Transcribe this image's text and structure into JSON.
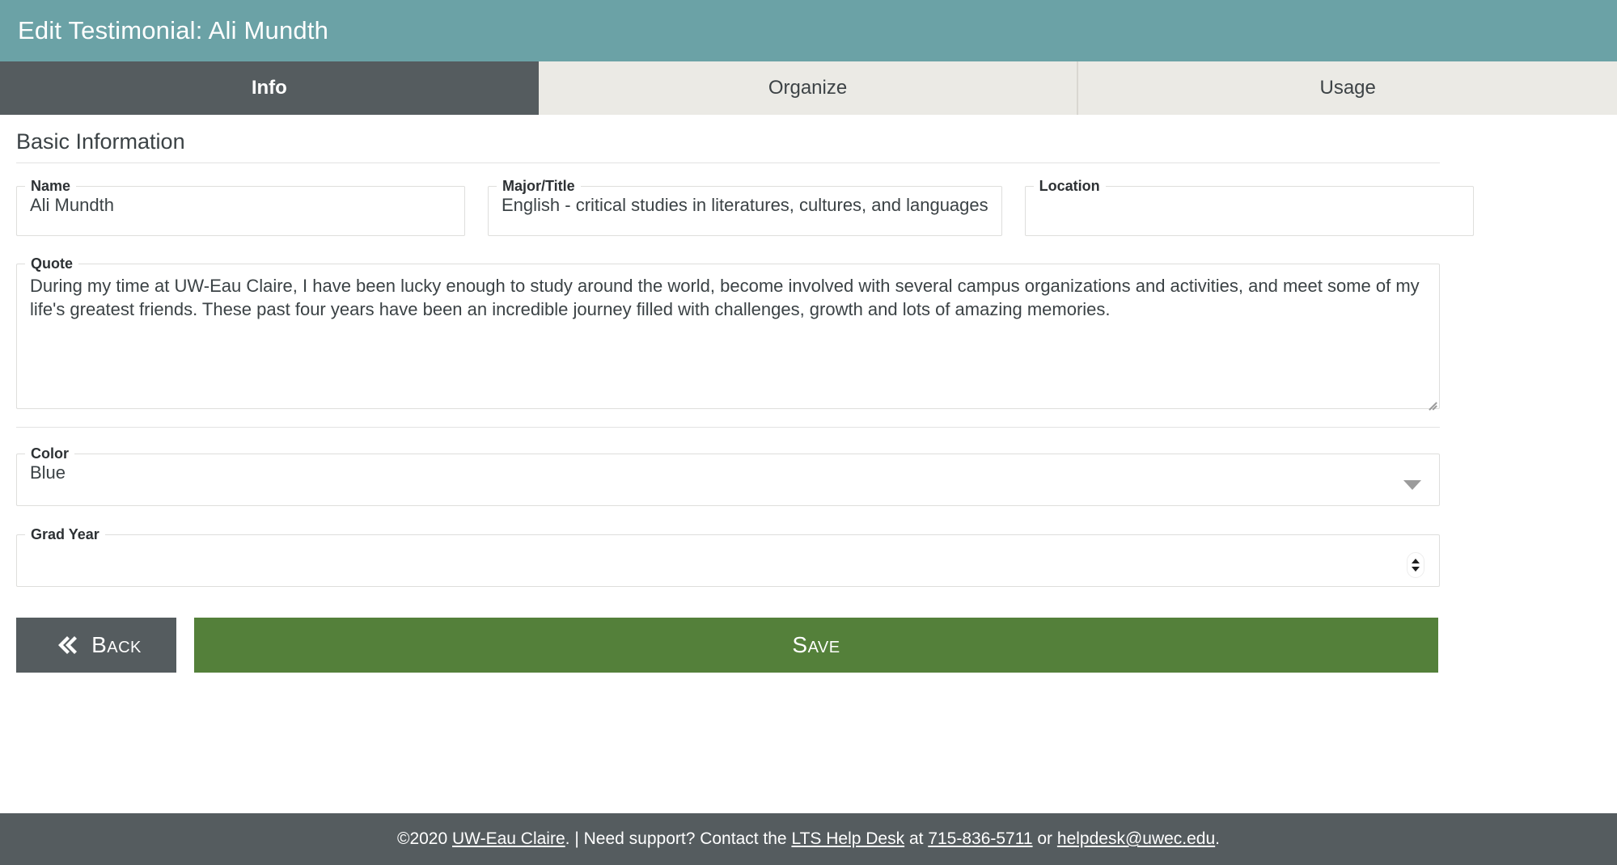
{
  "header": {
    "title": "Edit Testimonial: Ali Mundth"
  },
  "tabs": [
    {
      "label": "Info",
      "active": true
    },
    {
      "label": "Organize",
      "active": false
    },
    {
      "label": "Usage",
      "active": false
    }
  ],
  "main": {
    "section_title": "Basic Information",
    "fields": {
      "name": {
        "label": "Name",
        "value": "Ali Mundth"
      },
      "major": {
        "label": "Major/Title",
        "value": "English - critical studies in literatures, cultures, and languages"
      },
      "location": {
        "label": "Location",
        "value": ""
      },
      "quote": {
        "label": "Quote",
        "value": "During my time at UW-Eau Claire, I have been lucky enough to study around the world, become involved with several campus organizations and activities, and meet some of my life's greatest friends. These past four years have been an incredible journey filled with challenges, growth and lots of amazing memories."
      },
      "color": {
        "label": "Color",
        "value": "Blue"
      },
      "grad_year": {
        "label": "Grad Year",
        "value": ""
      }
    }
  },
  "buttons": {
    "back": "Back",
    "save": "Save"
  },
  "footer": {
    "copyright": "©2020 ",
    "org": "UW-Eau Claire",
    "sep": ". | Need support? Contact the ",
    "helpdesk": "LTS Help Desk",
    "at": " at ",
    "phone": "715-836-5711",
    "or": " or ",
    "email": "helpdesk@uwec.edu",
    "period": "."
  },
  "colors": {
    "header_teal": "#6ba2a6",
    "tab_active": "#555c5f",
    "tab_inactive": "#ebeae5",
    "save_green": "#54803a",
    "footer_gray": "#555c5f"
  }
}
